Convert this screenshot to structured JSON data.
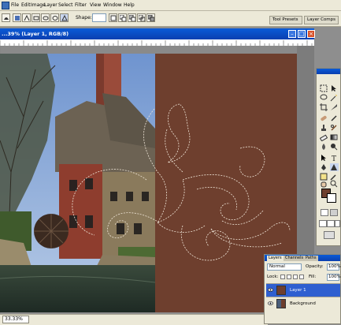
{
  "menubar": {
    "items": [
      "File",
      "Edit",
      "Image",
      "Layer",
      "Select",
      "Filter",
      "View",
      "Window",
      "Help"
    ]
  },
  "options_bar": {
    "shape_label": "Shape:",
    "shape_value": "",
    "palette_tabs": [
      "Tool Presets",
      "Layer Comps"
    ]
  },
  "document": {
    "title": "...39% (Layer 1, RGB/8)",
    "controls": [
      "minimize",
      "maximize",
      "close"
    ]
  },
  "status": {
    "zoom": "33.33%"
  },
  "colors": {
    "foreground": "#6e3f2e",
    "background": "#ffffff",
    "canvas_fill": "#6e3f2e",
    "selection_accent": "#2f5fd0"
  },
  "layers_panel": {
    "tabs": [
      "Layers",
      "Channels",
      "Paths"
    ],
    "blend_mode": "Normal",
    "opacity_label": "Opacity:",
    "opacity_value": "100%",
    "lock_label": "Lock:",
    "fill_label": "Fill:",
    "fill_value": "100%",
    "layers": [
      {
        "name": "Layer 1",
        "selected": true,
        "visible": true
      },
      {
        "name": "Background",
        "selected": false,
        "visible": true
      }
    ]
  }
}
